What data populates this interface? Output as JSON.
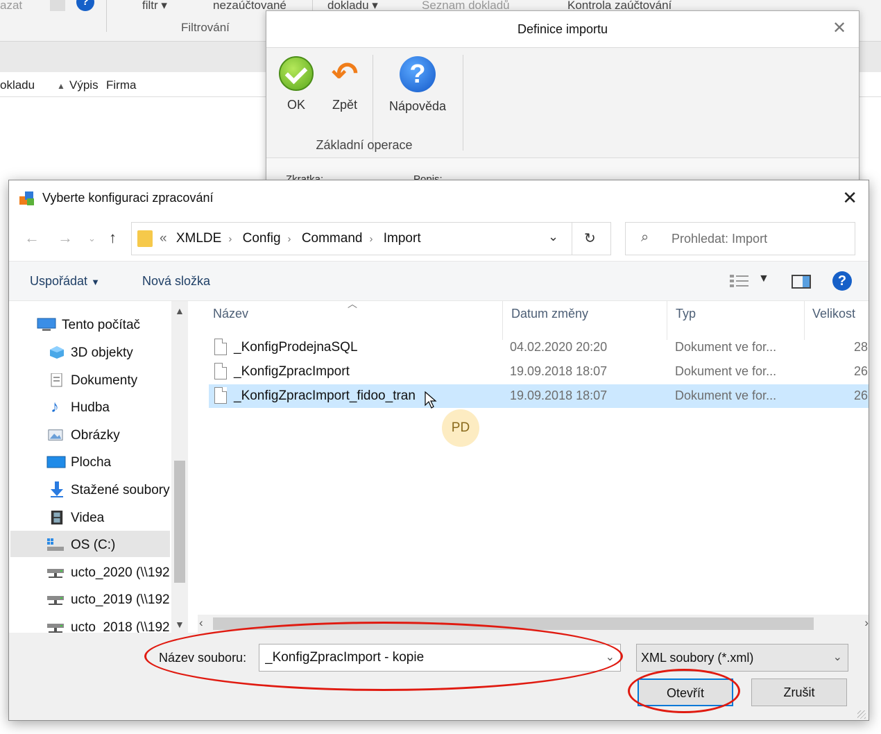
{
  "background_app": {
    "ribbon_items": [
      "azat",
      "filtr",
      "nezaúčtované",
      "dokladu",
      "Seznam dokladů",
      "Kontrola zaúčtování"
    ],
    "group_label": "Filtrování",
    "columns": [
      "okladu",
      "Výpis",
      "Firma"
    ]
  },
  "definice_window": {
    "title": "Definice importu",
    "buttons": [
      {
        "label": "OK",
        "icon": "ok-check-icon"
      },
      {
        "label": "Zpět",
        "icon": "back-arrow-icon"
      },
      {
        "label": "Nápověda",
        "icon": "help-icon"
      }
    ],
    "group_label": "Základní operace",
    "columns": [
      "Zkratka:",
      "Popis:"
    ]
  },
  "dialog": {
    "title": "Vyberte konfiguraci zpracování",
    "breadcrumb": [
      "XMLDE",
      "Config",
      "Command",
      "Import"
    ],
    "breadcrumb_prefix": "«",
    "search_placeholder": "Prohledat: Import",
    "toolbar": {
      "organize": "Uspořádat",
      "new_folder": "Nová složka"
    },
    "nav_items": [
      {
        "label": "Tento počítač",
        "icon": "computer-icon"
      },
      {
        "label": "3D objekty",
        "icon": "3d-objects-icon"
      },
      {
        "label": "Dokumenty",
        "icon": "documents-icon"
      },
      {
        "label": "Hudba",
        "icon": "music-icon"
      },
      {
        "label": "Obrázky",
        "icon": "pictures-icon"
      },
      {
        "label": "Plocha",
        "icon": "desktop-icon"
      },
      {
        "label": "Stažené soubory",
        "icon": "downloads-icon"
      },
      {
        "label": "Videa",
        "icon": "videos-icon"
      },
      {
        "label": "OS (C:)",
        "icon": "drive-icon"
      },
      {
        "label": "ucto_2020 (\\\\192",
        "icon": "network-drive-icon"
      },
      {
        "label": "ucto_2019 (\\\\192",
        "icon": "network-drive-icon"
      },
      {
        "label": "ucto_2018 (\\\\192",
        "icon": "network-drive-icon"
      }
    ],
    "columns": {
      "name": "Název",
      "date": "Datum změny",
      "type": "Typ",
      "size": "Velikost"
    },
    "files": [
      {
        "name": "_KonfigProdejnaSQL",
        "date": "04.02.2020 20:20",
        "type": "Dokument ve for...",
        "size": "28"
      },
      {
        "name": "_KonfigZpracImport",
        "date": "19.09.2018 18:07",
        "type": "Dokument ve for...",
        "size": "26"
      },
      {
        "name": "_KonfigZpracImport_fidoo_tran",
        "date": "19.09.2018 18:07",
        "type": "Dokument ve for...",
        "size": "26"
      }
    ],
    "cursor_badge": "PD",
    "filename_label": "Název souboru:",
    "filename_value": "_KonfigZpracImport - kopie",
    "filetype": "XML soubory (*.xml)",
    "open_button": "Otevřít",
    "cancel_button": "Zrušit"
  },
  "colors": {
    "annotation": "#e01a10",
    "selection": "#cce8ff",
    "accent": "#0078d7"
  }
}
